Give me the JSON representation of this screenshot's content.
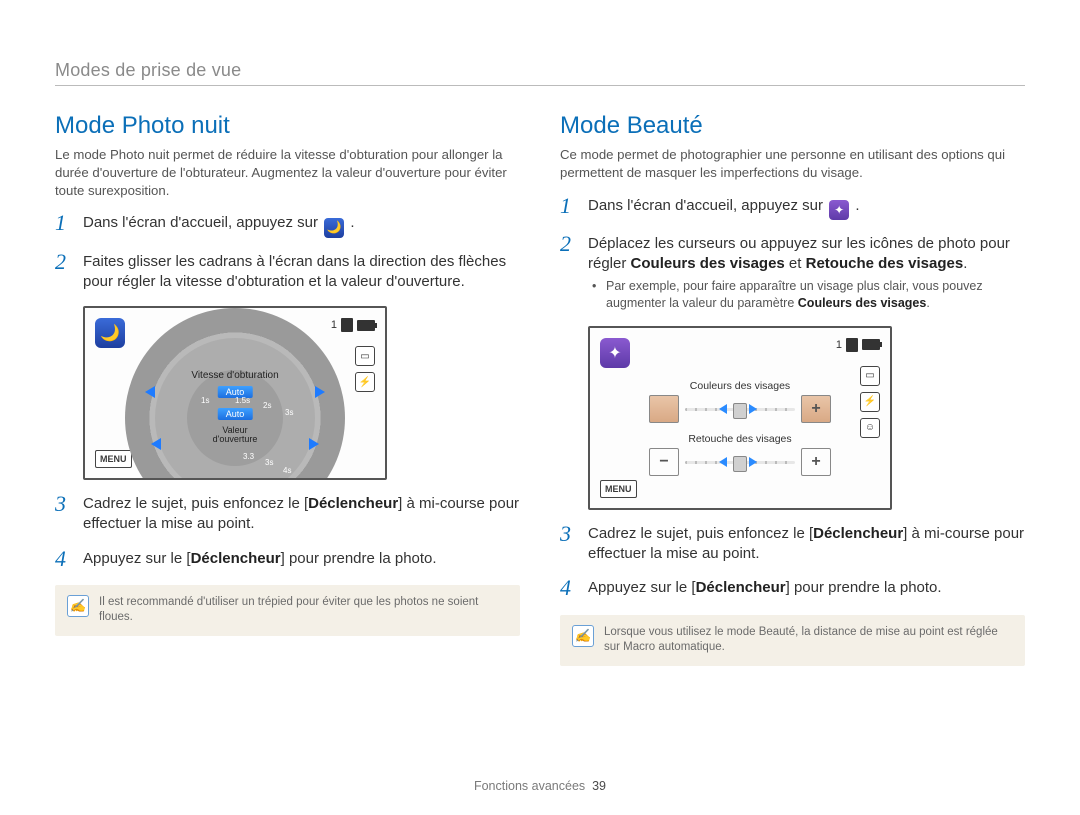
{
  "header": {
    "section": "Modes de prise de vue"
  },
  "footer": {
    "label": "Fonctions avancées",
    "page": "39"
  },
  "left": {
    "title": "Mode Photo nuit",
    "intro": "Le mode Photo nuit permet de réduire la vitesse d'obturation pour allonger la durée d'ouverture de l'obturateur. Augmentez la valeur d'ouverture pour éviter toute surexposition.",
    "steps": {
      "s1_num": "1",
      "s1_pre": "Dans l'écran d'accueil, appuyez sur ",
      "s1_post": ".",
      "s2_num": "2",
      "s2": "Faites glisser les cadrans à l'écran dans la direction des flèches pour régler la vitesse d'obturation et la valeur d'ouverture.",
      "s3_num": "3",
      "s3_a": "Cadrez le sujet, puis enfoncez le [",
      "s3_b": "Déclencheur",
      "s3_c": "] à mi-course pour effectuer la mise au point.",
      "s4_num": "4",
      "s4_a": "Appuyez sur le [",
      "s4_b": "Déclencheur",
      "s4_c": "] pour prendre la photo."
    },
    "note": "Il est recommandé d'utiliser un trépied pour éviter que les photos ne soient floues.",
    "screen": {
      "top_count": "1",
      "menu": "MENU",
      "shutter_label": "Vitesse d'obturation",
      "aperture_label_l1": "Valeur",
      "aperture_label_l2": "d'ouverture",
      "auto": "Auto",
      "ticks_shutter": [
        "1s",
        "1.5s",
        "2s",
        "3s"
      ],
      "ticks_aperture": [
        "3.3",
        "3s",
        "4s"
      ]
    }
  },
  "right": {
    "title": "Mode Beauté",
    "intro": "Ce mode permet de photographier une personne en utilisant des options qui permettent de masquer les imperfections du visage.",
    "steps": {
      "s1_num": "1",
      "s1_pre": "Dans l'écran d'accueil, appuyez sur ",
      "s1_post": ".",
      "s2_num": "2",
      "s2_a": "Déplacez les curseurs ou appuyez sur les icônes de photo pour régler ",
      "s2_b": "Couleurs des visages",
      "s2_c": " et ",
      "s2_d": "Retouche des visages",
      "s2_e": ".",
      "sub_a": "Par exemple, pour faire apparaître un visage plus clair, vous pouvez augmenter la valeur du paramètre ",
      "sub_b": "Couleurs des visages",
      "sub_c": ".",
      "s3_num": "3",
      "s3_a": "Cadrez le sujet, puis enfoncez le [",
      "s3_b": "Déclencheur",
      "s3_c": "] à mi-course pour effectuer la mise au point.",
      "s4_num": "4",
      "s4_a": "Appuyez sur le [",
      "s4_b": "Déclencheur",
      "s4_c": "] pour prendre la photo."
    },
    "note": "Lorsque vous utilisez le mode Beauté, la distance de mise au point est réglée sur Macro automatique.",
    "screen": {
      "top_count": "1",
      "menu": "MENU",
      "slider1_label": "Couleurs des visages",
      "slider2_label": "Retouche des visages",
      "minus": "−",
      "plus": "+"
    }
  }
}
